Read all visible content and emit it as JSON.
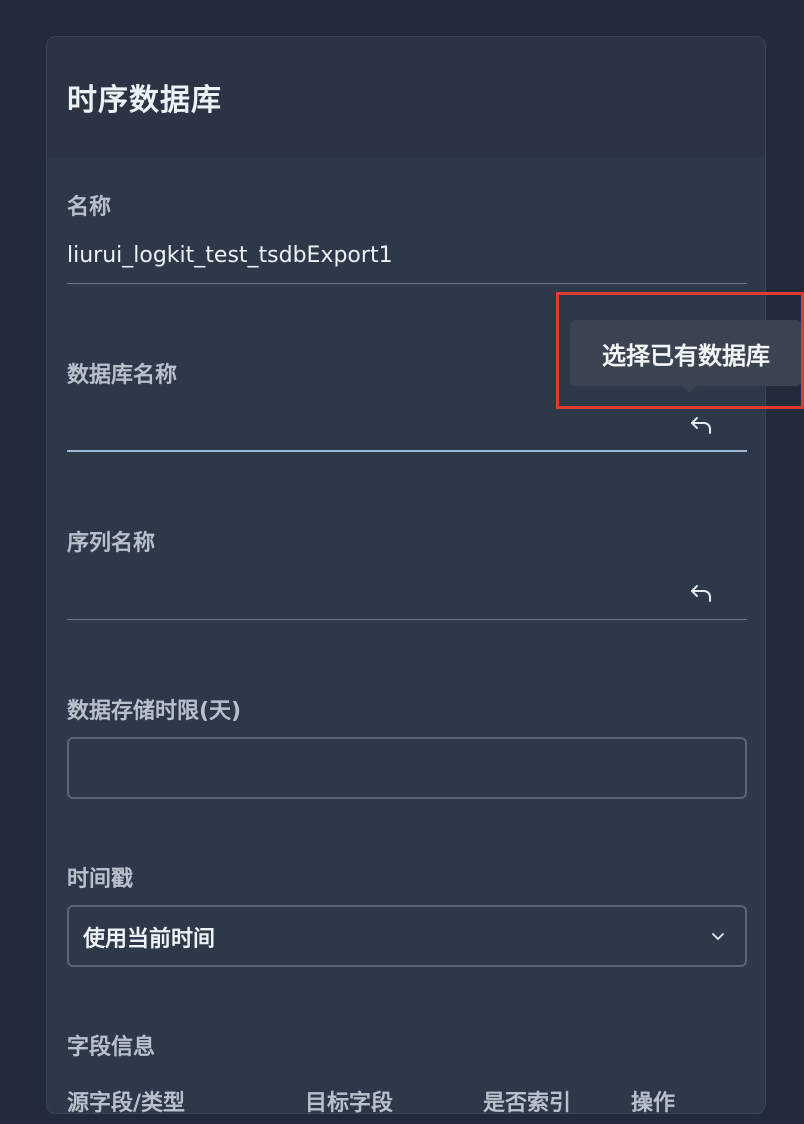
{
  "header": {
    "title": "时序数据库"
  },
  "form": {
    "name": {
      "label": "名称",
      "value": "liurui_logkit_test_tsdbExport1"
    },
    "database": {
      "label": "数据库名称",
      "value": ""
    },
    "series": {
      "label": "序列名称",
      "value": ""
    },
    "retention": {
      "label": "数据存储时限(天)",
      "value": ""
    },
    "timestamp": {
      "label": "时间戳",
      "selected": "使用当前时间"
    },
    "fields": {
      "label": "字段信息",
      "columns": [
        "源字段/类型",
        "目标字段",
        "是否索引",
        "操作"
      ]
    }
  },
  "tooltip": {
    "text": "选择已有数据库"
  },
  "icons": {
    "reverse": "reply-arrow-icon",
    "dropdown": "chevron-down-icon"
  },
  "colors": {
    "highlight": "#e03b30",
    "focus_underline": "#9fb8d8"
  }
}
